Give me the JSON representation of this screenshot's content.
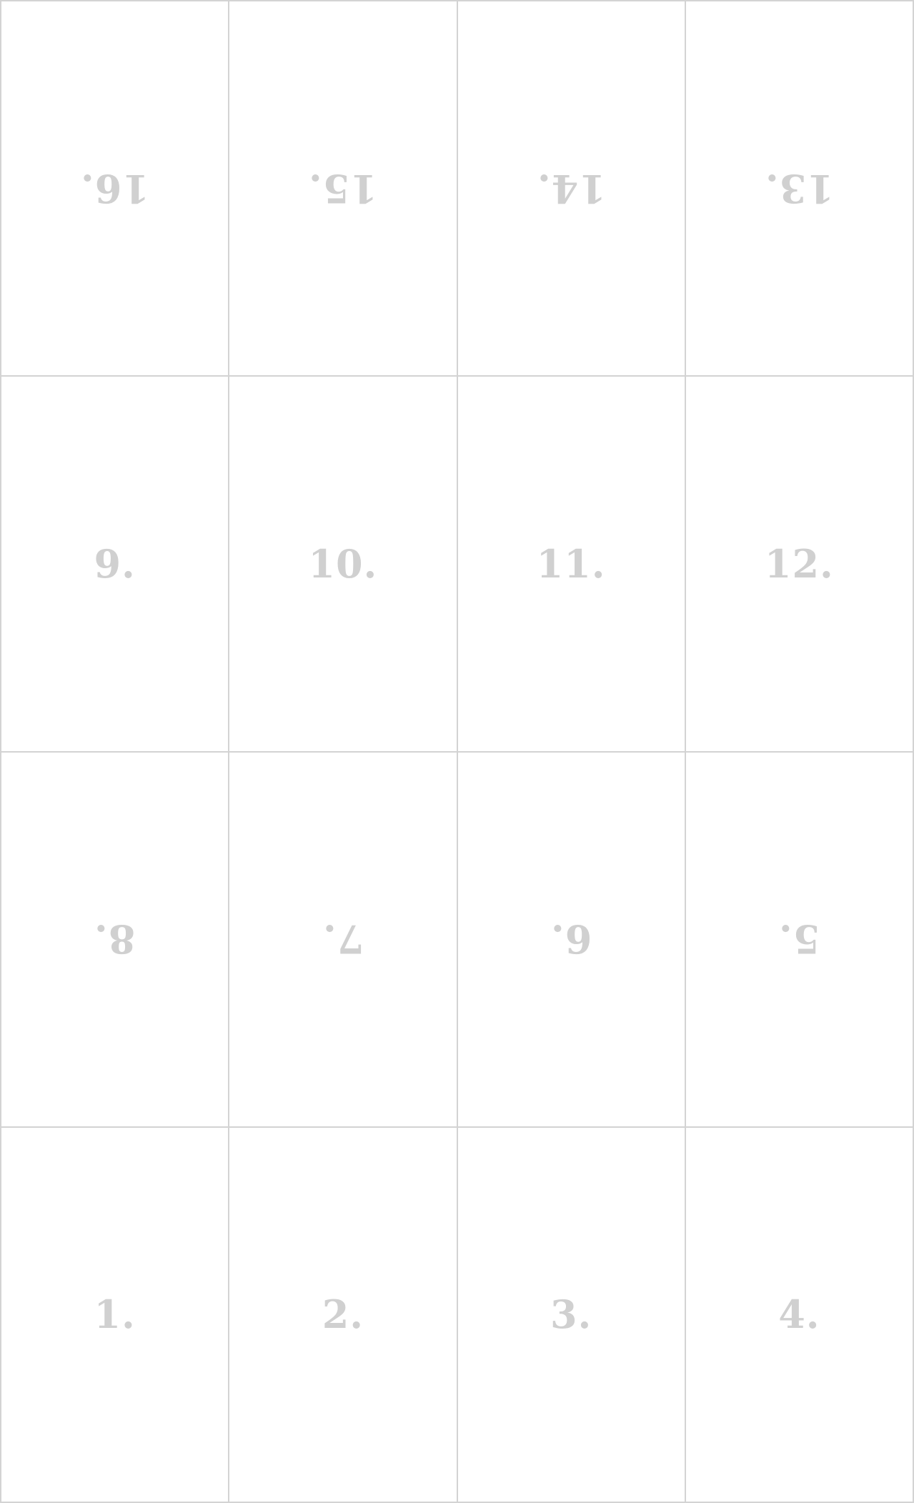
{
  "grid": {
    "rows": [
      {
        "cells": [
          {
            "label": "16.",
            "rotated": true
          },
          {
            "label": "15.",
            "rotated": true
          },
          {
            "label": "14.",
            "rotated": true
          },
          {
            "label": "13.",
            "rotated": true
          }
        ]
      },
      {
        "cells": [
          {
            "label": "9.",
            "rotated": false
          },
          {
            "label": "10.",
            "rotated": false
          },
          {
            "label": "11.",
            "rotated": false
          },
          {
            "label": "12.",
            "rotated": false
          }
        ]
      },
      {
        "cells": [
          {
            "label": "8.",
            "rotated": true
          },
          {
            "label": "7.",
            "rotated": true
          },
          {
            "label": "6.",
            "rotated": true
          },
          {
            "label": "5.",
            "rotated": true
          }
        ]
      },
      {
        "cells": [
          {
            "label": "1.",
            "rotated": false
          },
          {
            "label": "2.",
            "rotated": false
          },
          {
            "label": "3.",
            "rotated": false
          },
          {
            "label": "4.",
            "rotated": false
          }
        ]
      }
    ]
  },
  "colors": {
    "grid_line": "#d3d3d3",
    "label_text": "#d0d0d0",
    "background": "#ffffff"
  }
}
